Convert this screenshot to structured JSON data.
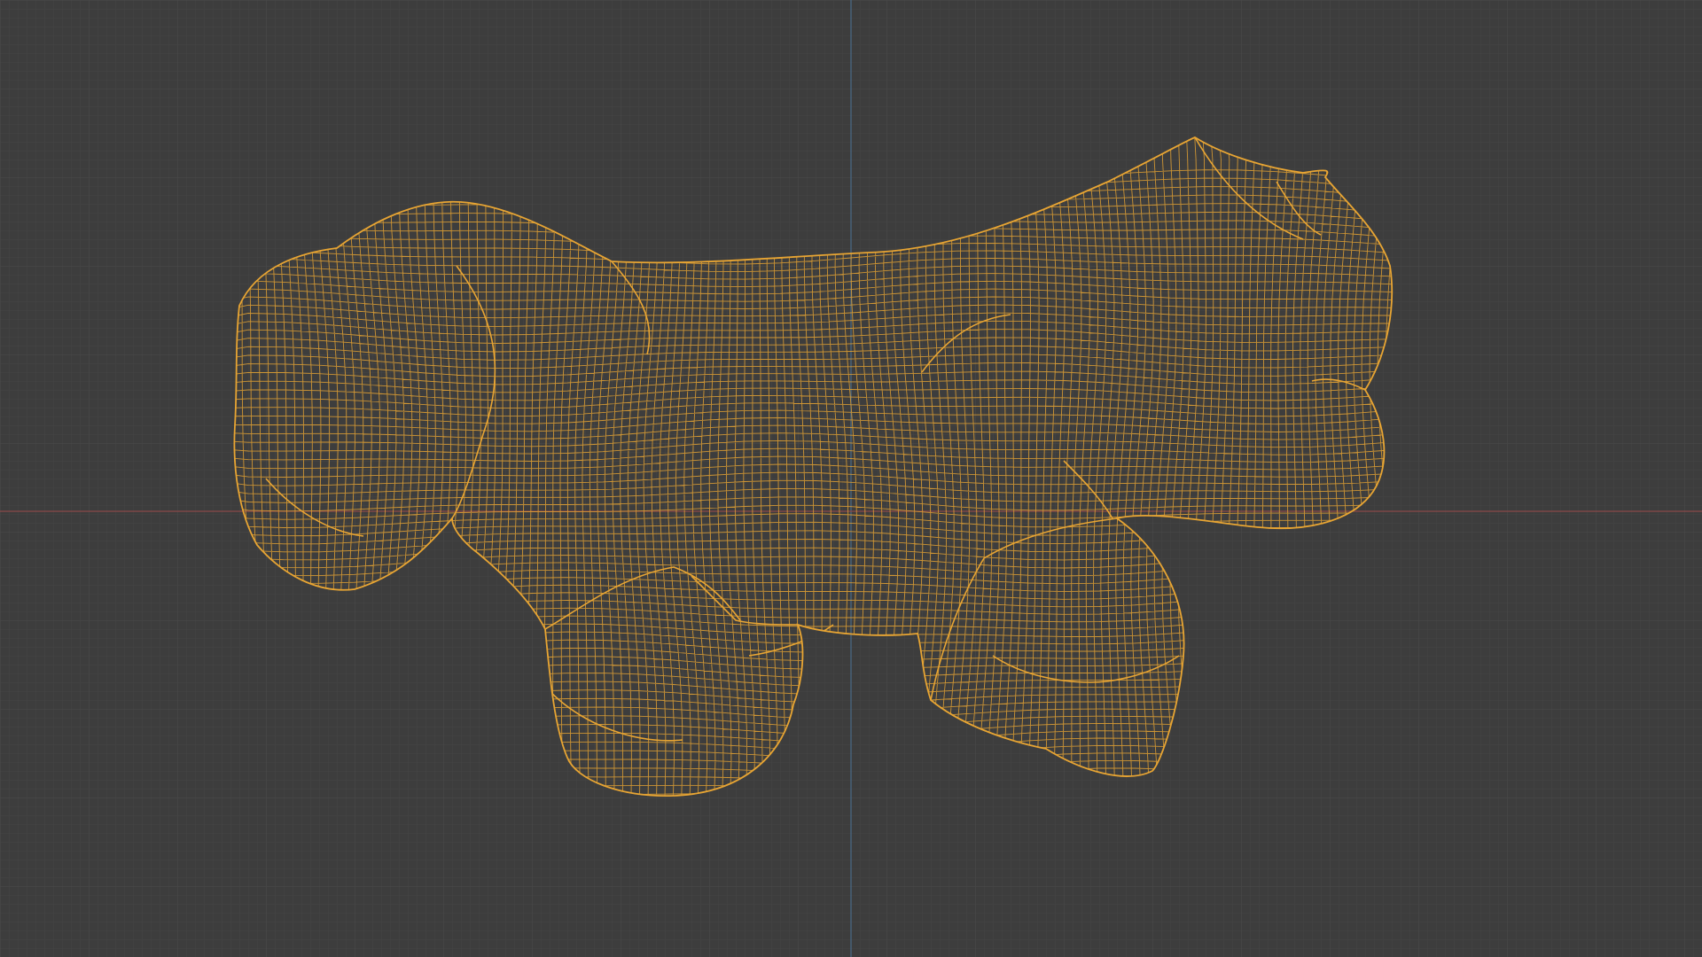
{
  "viewport": {
    "background_color": "#3d3d3d",
    "grid_minor_color": "#454545",
    "grid_major_color": "#4a4a4a",
    "axis_x_color": "#8a4a4a",
    "axis_y_color": "#4a6a88",
    "grid_visible": true
  },
  "object": {
    "display_mode": "wireframe",
    "wire_color": "#e8a533",
    "selected": true
  }
}
